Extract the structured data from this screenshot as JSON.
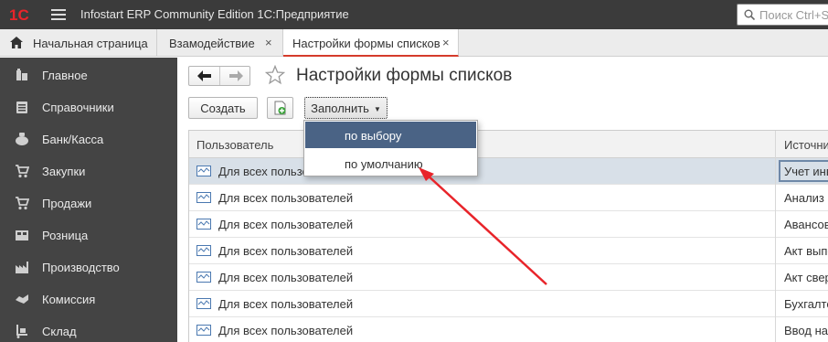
{
  "app": {
    "logo_text": "1С",
    "title": "Infostart ERP Community Edition 1С:Предприятие",
    "search_placeholder": "Поиск Ctrl+Shift+F"
  },
  "tabs": [
    {
      "label": "Начальная страница"
    },
    {
      "label": "Взамодействие",
      "close": "×"
    },
    {
      "label": "Настройки формы списков",
      "close": "×"
    }
  ],
  "sidebar": {
    "items": [
      {
        "label": "Главное",
        "icon": "main-icon"
      },
      {
        "label": "Справочники",
        "icon": "catalogs-icon"
      },
      {
        "label": "Банк/Касса",
        "icon": "bank-icon"
      },
      {
        "label": "Закупки",
        "icon": "purchases-icon"
      },
      {
        "label": "Продажи",
        "icon": "sales-icon"
      },
      {
        "label": "Розница",
        "icon": "retail-icon"
      },
      {
        "label": "Производство",
        "icon": "production-icon"
      },
      {
        "label": "Комиссия",
        "icon": "commission-icon"
      },
      {
        "label": "Склад",
        "icon": "warehouse-icon"
      }
    ]
  },
  "form": {
    "title": "Настройки формы списков",
    "create_label": "Создать",
    "fill_label": "Заполнить"
  },
  "dropdown": {
    "items": [
      "по выбору",
      "по умолчанию"
    ]
  },
  "table": {
    "columns": [
      "Пользователь",
      "Источни"
    ],
    "rows": [
      {
        "user": "Для всех пользоват",
        "source": "Учет инв"
      },
      {
        "user": "Для всех пользователей",
        "source": "Анализ"
      },
      {
        "user": "Для всех пользователей",
        "source": "Авансов"
      },
      {
        "user": "Для всех пользователей",
        "source": "Акт выпо"
      },
      {
        "user": "Для всех пользователей",
        "source": "Акт сверк"
      },
      {
        "user": "Для всех пользователей",
        "source": "Бухгалтер"
      },
      {
        "user": "Для всех пользователей",
        "source": "Ввод нач"
      }
    ]
  },
  "colors": {
    "titlebar": "#3b3b3b",
    "sidebar": "#444444",
    "accent_tab": "#d53b2b",
    "menu_highlight": "#4a6385",
    "annotation_arrow": "#e8242a"
  }
}
